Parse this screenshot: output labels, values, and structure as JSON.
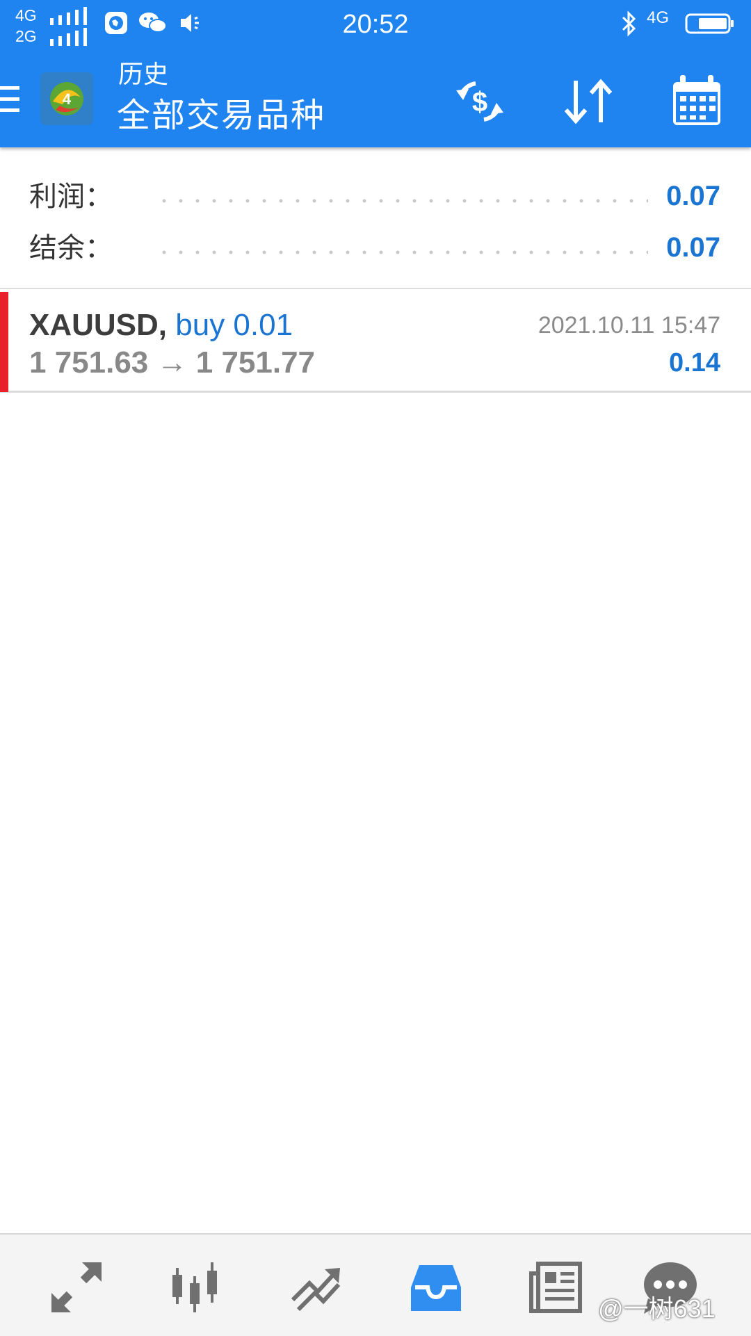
{
  "status_bar": {
    "net_top": "4G",
    "net_bottom": "2G",
    "clock": "20:52",
    "net_right": "4G"
  },
  "app_bar": {
    "subtitle": "历史",
    "title": "全部交易品种",
    "menu_icon": "hamburger-icon",
    "actions": [
      "dollar-refresh-icon",
      "sort-icon",
      "calendar-icon"
    ]
  },
  "summary": {
    "profit_label": "利润：",
    "profit_value": "0.07",
    "balance_label": "结余：",
    "balance_value": "0.07"
  },
  "trades": [
    {
      "symbol": "XAUUSD,",
      "side": "buy 0.01",
      "open_price": "1 751.63",
      "arrow": "→",
      "close_price": "1 751.77",
      "time": "2021.10.11 15:47",
      "profit": "0.14",
      "side_color": "#e8202a"
    }
  ],
  "bottom_nav": {
    "items": [
      "quotes-icon",
      "chart-candles-icon",
      "trade-icon",
      "history-icon",
      "news-icon",
      "chat-icon"
    ],
    "active": "history-icon"
  },
  "watermark": "@一树631",
  "colors": {
    "primary": "#1f84f0",
    "value_blue": "#1a75d2",
    "loss_red": "#e8202a"
  }
}
